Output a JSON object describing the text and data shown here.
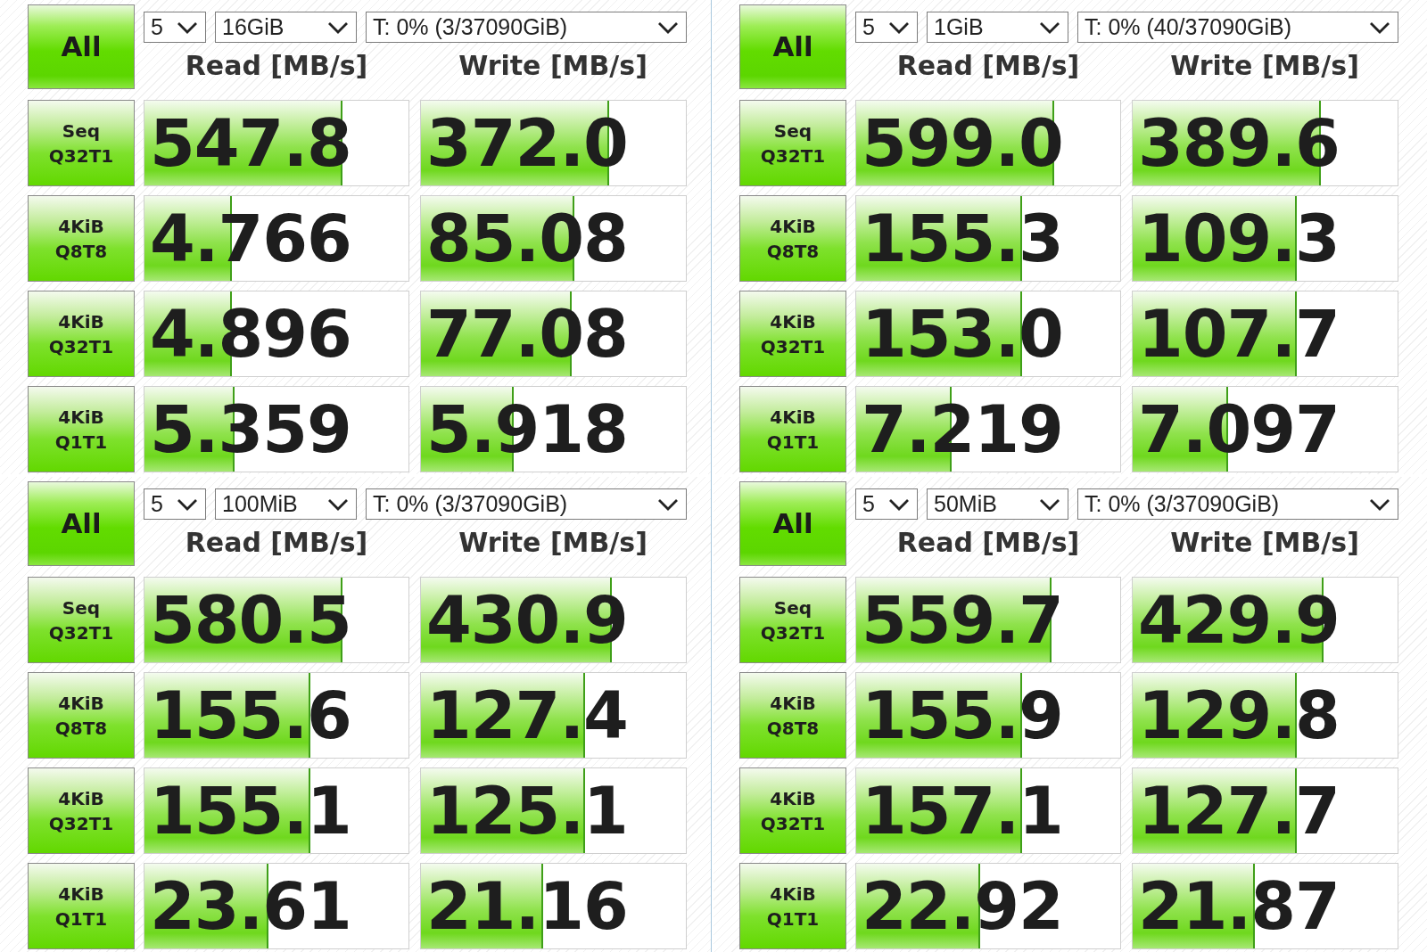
{
  "panels": [
    {
      "all_button": "All",
      "dropdowns": [
        {
          "kind": "runs",
          "value": "5"
        },
        {
          "kind": "size",
          "value": "16GiB"
        },
        {
          "kind": "drive",
          "value": "T: 0% (3/37090GiB)"
        }
      ],
      "headers": [
        "Read [MB/s]",
        "Write [MB/s]"
      ],
      "tests": [
        {
          "label": [
            "Seq",
            "Q32T1"
          ],
          "read": {
            "value": "547.8",
            "level": 0.75
          },
          "write": {
            "value": "372.0",
            "level": 0.71
          }
        },
        {
          "label": [
            "4KiB",
            "Q8T8"
          ],
          "read": {
            "value": "4.766",
            "level": 0.33
          },
          "write": {
            "value": "85.08",
            "level": 0.58
          }
        },
        {
          "label": [
            "4KiB",
            "Q32T1"
          ],
          "read": {
            "value": "4.896",
            "level": 0.33
          },
          "write": {
            "value": "77.08",
            "level": 0.57
          }
        },
        {
          "label": [
            "4KiB",
            "Q1T1"
          ],
          "read": {
            "value": "5.359",
            "level": 0.34
          },
          "write": {
            "value": "5.918",
            "level": 0.35
          }
        }
      ]
    },
    {
      "all_button": "All",
      "dropdowns": [
        {
          "kind": "runs",
          "value": "5"
        },
        {
          "kind": "size",
          "value": "1GiB"
        },
        {
          "kind": "drive",
          "value": "T: 0% (40/37090GiB)"
        }
      ],
      "headers": [
        "Read [MB/s]",
        "Write [MB/s]"
      ],
      "tests": [
        {
          "label": [
            "Seq",
            "Q32T1"
          ],
          "read": {
            "value": "599.0",
            "level": 0.75
          },
          "write": {
            "value": "389.6",
            "level": 0.71
          }
        },
        {
          "label": [
            "4KiB",
            "Q8T8"
          ],
          "read": {
            "value": "155.3",
            "level": 0.63
          },
          "write": {
            "value": "109.3",
            "level": 0.62
          }
        },
        {
          "label": [
            "4KiB",
            "Q32T1"
          ],
          "read": {
            "value": "153.0",
            "level": 0.63
          },
          "write": {
            "value": "107.7",
            "level": 0.62
          }
        },
        {
          "label": [
            "4KiB",
            "Q1T1"
          ],
          "read": {
            "value": "7.219",
            "level": 0.36
          },
          "write": {
            "value": "7.097",
            "level": 0.36
          }
        }
      ]
    },
    {
      "all_button": "All",
      "dropdowns": [
        {
          "kind": "runs",
          "value": "5"
        },
        {
          "kind": "size",
          "value": "100MiB"
        },
        {
          "kind": "drive",
          "value": "T: 0% (3/37090GiB)"
        }
      ],
      "headers": [
        "Read [MB/s]",
        "Write [MB/s]"
      ],
      "tests": [
        {
          "label": [
            "Seq",
            "Q32T1"
          ],
          "read": {
            "value": "580.5",
            "level": 0.75
          },
          "write": {
            "value": "430.9",
            "level": 0.72
          }
        },
        {
          "label": [
            "4KiB",
            "Q8T8"
          ],
          "read": {
            "value": "155.6",
            "level": 0.63
          },
          "write": {
            "value": "127.4",
            "level": 0.62
          }
        },
        {
          "label": [
            "4KiB",
            "Q32T1"
          ],
          "read": {
            "value": "155.1",
            "level": 0.63
          },
          "write": {
            "value": "125.1",
            "level": 0.62
          }
        },
        {
          "label": [
            "4KiB",
            "Q1T1"
          ],
          "read": {
            "value": "23.61",
            "level": 0.47
          },
          "write": {
            "value": "21.16",
            "level": 0.46
          }
        }
      ]
    },
    {
      "all_button": "All",
      "dropdowns": [
        {
          "kind": "runs",
          "value": "5"
        },
        {
          "kind": "size",
          "value": "50MiB"
        },
        {
          "kind": "drive",
          "value": "T: 0% (3/37090GiB)"
        }
      ],
      "headers": [
        "Read [MB/s]",
        "Write [MB/s]"
      ],
      "tests": [
        {
          "label": [
            "Seq",
            "Q32T1"
          ],
          "read": {
            "value": "559.7",
            "level": 0.74
          },
          "write": {
            "value": "429.9",
            "level": 0.72
          }
        },
        {
          "label": [
            "4KiB",
            "Q8T8"
          ],
          "read": {
            "value": "155.9",
            "level": 0.63
          },
          "write": {
            "value": "129.8",
            "level": 0.62
          }
        },
        {
          "label": [
            "4KiB",
            "Q32T1"
          ],
          "read": {
            "value": "157.1",
            "level": 0.63
          },
          "write": {
            "value": "127.7",
            "level": 0.62
          }
        },
        {
          "label": [
            "4KiB",
            "Q1T1"
          ],
          "read": {
            "value": "22.92",
            "level": 0.47
          },
          "write": {
            "value": "21.87",
            "level": 0.46
          }
        }
      ]
    }
  ]
}
